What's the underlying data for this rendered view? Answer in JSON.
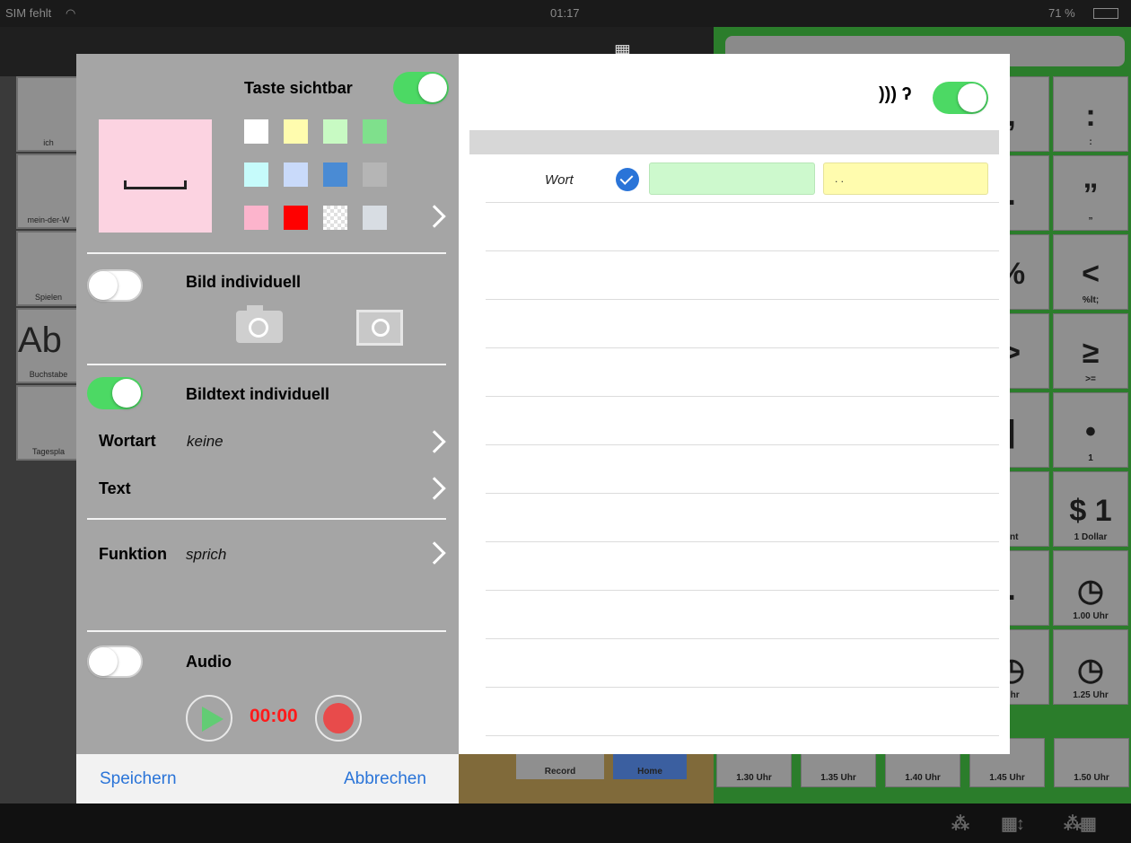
{
  "status_bar": {
    "carrier": "SIM fehlt",
    "time": "01:17",
    "battery": "71 %"
  },
  "background": {
    "left_cells": [
      "ich",
      "mein-der-W",
      "Spielen",
      "Buchstabe",
      "Tagespla"
    ],
    "left_letters": "Ab",
    "grid_cells": [
      {
        "sym": ",",
        "cap": ""
      },
      {
        "sym": ":",
        "cap": ":"
      },
      {
        "sym": ".",
        "cap": ""
      },
      {
        "sym": "”",
        "cap": "”"
      },
      {
        "sym": "%",
        "cap": ""
      },
      {
        "sym": "<",
        "cap": "%lt;"
      },
      {
        "sym": ">",
        "cap": ""
      },
      {
        "sym": "≥",
        "cap": ">="
      },
      {
        "sym": "|",
        "cap": ""
      },
      {
        "sym": "•",
        "cap": "1"
      },
      {
        "sym": "",
        "cap": "ent"
      },
      {
        "sym": "$ 1",
        "cap": "1 Dollar"
      },
      {
        "sym": ".",
        "cap": ""
      },
      {
        "sym": "◷",
        "cap": "1.00 Uhr"
      },
      {
        "sym": "◷",
        "cap": "Uhr"
      },
      {
        "sym": "◷",
        "cap": "1.25 Uhr"
      }
    ],
    "bottom_clock_labels": [
      "1.30 Uhr",
      "1.35 Uhr",
      "1.40 Uhr",
      "1.45 Uhr",
      "1.50 Uhr"
    ],
    "mid_buttons": [
      "Record",
      "Home"
    ]
  },
  "left_panel": {
    "taste_sichtbar_label": "Taste sichtbar",
    "preview_symbol": "␣",
    "swatches": [
      "#ffffff",
      "#fffcae",
      "#c8fac3",
      "#7fe08c",
      "#c6fbfb",
      "#c9dafa",
      "#4a8bd4",
      "#b5b5b5",
      "#fcb4cc",
      "#ff0000",
      "checker",
      "#d8dde3"
    ],
    "bild_individuell_label": "Bild individuell",
    "bildtext_individuell_label": "Bildtext individuell",
    "wortart_label": "Wortart",
    "wortart_value": "keine",
    "text_label": "Text",
    "funktion_label": "Funktion",
    "funktion_value": "sprich",
    "audio_label": "Audio",
    "audio_time": "00:00",
    "save_label": "Speichern",
    "cancel_label": "Abbrechen"
  },
  "right_panel": {
    "speak_icon": "ear-icon",
    "row_label": "Wort",
    "yellow_field_value": ". ."
  },
  "colors": {
    "accent_green": "#4cd964",
    "link_blue": "#2a74d8",
    "record_red": "#e84b4b",
    "time_red": "#ff1a1a"
  }
}
